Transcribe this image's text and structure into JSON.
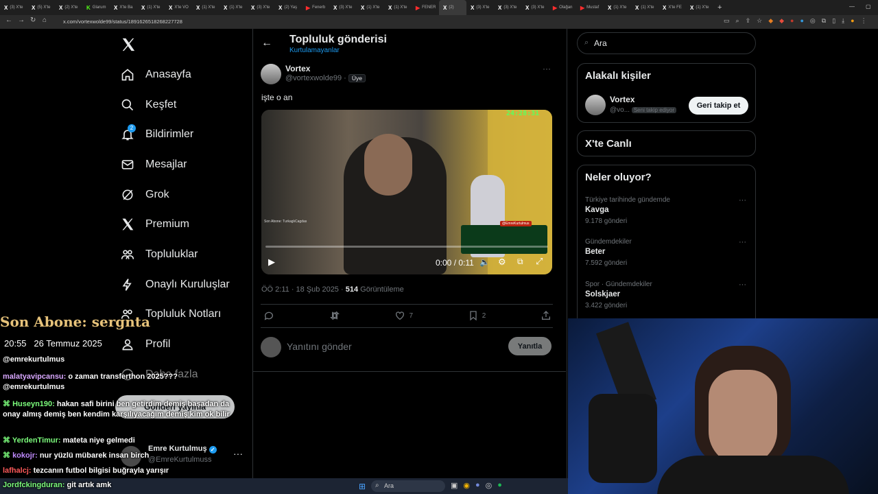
{
  "browser": {
    "tabs": [
      {
        "icon": "X",
        "label": "(3) X'te"
      },
      {
        "icon": "X",
        "label": "(5) X'te"
      },
      {
        "icon": "X",
        "label": "(2) X'te"
      },
      {
        "icon": "K",
        "label": "Glarum"
      },
      {
        "icon": "X",
        "label": "X'te Ba"
      },
      {
        "icon": "X",
        "label": "(1) X'te"
      },
      {
        "icon": "X",
        "label": "X'te VO"
      },
      {
        "icon": "X",
        "label": "(1) X'te"
      },
      {
        "icon": "X",
        "label": "(1) X'te"
      },
      {
        "icon": "X",
        "label": "(3) X'te"
      },
      {
        "icon": "X",
        "label": "(2) Yaş"
      },
      {
        "icon": "▶",
        "label": "Fenerb"
      },
      {
        "icon": "X",
        "label": "(3) X'te"
      },
      {
        "icon": "X",
        "label": "(1) X'te"
      },
      {
        "icon": "X",
        "label": "(1) X'te"
      },
      {
        "icon": "▶",
        "label": "FENER"
      },
      {
        "icon": "X",
        "label": "(2)"
      },
      {
        "icon": "X",
        "label": "(3) X'te"
      },
      {
        "icon": "X",
        "label": "(3) X'te"
      },
      {
        "icon": "X",
        "label": "(3) X'te"
      },
      {
        "icon": "▶",
        "label": "Olağan"
      },
      {
        "icon": "▶",
        "label": "Mustaf"
      },
      {
        "icon": "X",
        "label": "(1) X'te"
      },
      {
        "icon": "X",
        "label": "(1) X'te"
      },
      {
        "icon": "X",
        "label": "X'te FE"
      },
      {
        "icon": "X",
        "label": "(1) X'te"
      }
    ],
    "url": "x.com/vortexwolde99/status/1891626518268227728"
  },
  "nav": {
    "items": [
      "Anasayfa",
      "Keşfet",
      "Bildirimler",
      "Mesajlar",
      "Grok",
      "Premium",
      "Topluluklar",
      "Onaylı Kuruluşlar",
      "Topluluk Notları",
      "Profil",
      "Daha fazla"
    ],
    "notif_badge": "2",
    "post_button": "Gönderi yayınla",
    "account": {
      "name": "Emre Kurtulmuş",
      "handle": "@EmreKurtulmuss"
    }
  },
  "header": {
    "title": "Topluluk gönderisi",
    "subtitle": "Kurtulamayanlar"
  },
  "post": {
    "author": "Vortex",
    "handle": "@vortexwolde99",
    "member_badge": "Üye",
    "text": "işte o an",
    "video": {
      "timestamp_overlay": "24:28:31",
      "time": "0:00 / 0:11",
      "caption_overlay": "Son Abone: TurkaglıCagdas",
      "watermark": "@EmreKurtulmus",
      "progress": 0
    },
    "meta_time": "ÖÖ 2:11 · 18 Şub 2025 ·",
    "views_count": "514",
    "views_label": "Görüntüleme",
    "likes": "7",
    "bookmarks": "2",
    "reply_placeholder": "Yanıtını gönder",
    "reply_button": "Yanıtla"
  },
  "search": {
    "placeholder": "Ara"
  },
  "related": {
    "title": "Alakalı kişiler",
    "name": "Vortex",
    "handle": "@vo...",
    "follows_you": "Seni takip ediyor",
    "button": "Geri takip et"
  },
  "live": {
    "title": "X'te Canlı"
  },
  "trends": {
    "title": "Neler oluyor?",
    "items": [
      {
        "category": "Türkiye tarihinde gündemde",
        "name": "Kavga",
        "count": "9.178 gönderi"
      },
      {
        "category": "Gündemdekiler",
        "name": "Beter",
        "count": "7.592 gönderi"
      },
      {
        "category": "Spor · Gündemdekiler",
        "name": "Solskjaer",
        "count": "3.422 gönderi"
      }
    ]
  },
  "stream": {
    "last_sub": "Son Abone: sergnta",
    "clock": "20:55",
    "date": "26 Temmuz 2025",
    "messages": [
      {
        "user": "",
        "text": "@emrekurtulmus",
        "color": "#ffffff"
      },
      {
        "user": "malatyavipcansu:",
        "text": "o zaman transferthon 2025??? @emrekurtulmus",
        "color": "#d8a7ff"
      },
      {
        "user": "Huseyn190:",
        "text": "hakan safi birini ben getirdim demiş başadan da onay almış demiş ben kendim karşılıyacağım demiş kim ok bilir",
        "color": "#7cfc7c"
      },
      {
        "user": "YerdenTimur:",
        "text": "mateta niye gelmedi",
        "color": "#7cfc7c"
      },
      {
        "user": "kokojr:",
        "text": "nur yüzlü mübarek insan birch",
        "color": "#c08bff"
      },
      {
        "user": "lafhalcj:",
        "text": "tezcanın futbol bilgisi buğrayla yarışır",
        "color": "#ff5a5a"
      },
      {
        "user": "Jordfckingduran:",
        "text": "git artık amk",
        "color": "#7cfc7c"
      }
    ]
  },
  "taskbar": {
    "search": "Ara"
  },
  "colors": {
    "accent": "#1d9bf0",
    "bg": "#000000",
    "border": "#2f3336",
    "gold": "#e6c27a"
  }
}
